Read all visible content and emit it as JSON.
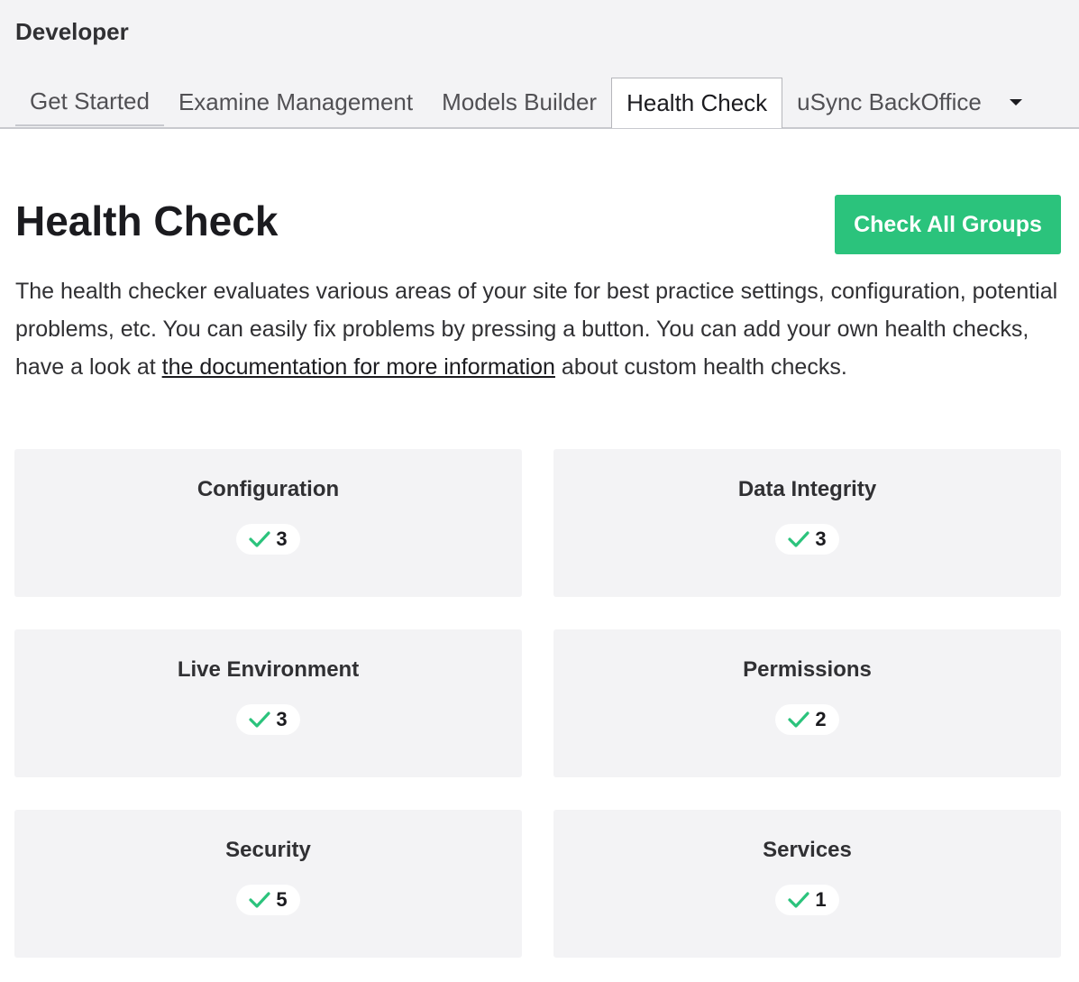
{
  "header": {
    "section": "Developer",
    "tabs": [
      {
        "label": "Get Started"
      },
      {
        "label": "Examine Management"
      },
      {
        "label": "Models Builder"
      },
      {
        "label": "Health Check"
      },
      {
        "label": "uSync BackOffice"
      }
    ],
    "active_tab": "Health Check"
  },
  "main": {
    "title": "Health Check",
    "check_all_label": "Check All Groups",
    "intro_before_link": "The health checker evaluates various areas of your site for best practice settings, configuration, potential problems, etc. You can easily fix problems by pressing a button. You can add your own health checks, have a look at ",
    "intro_link": "the documentation for more information",
    "intro_after_link": " about custom health checks.",
    "groups": [
      {
        "name": "Configuration",
        "count": "3"
      },
      {
        "name": "Data Integrity",
        "count": "3"
      },
      {
        "name": "Live Environment",
        "count": "3"
      },
      {
        "name": "Permissions",
        "count": "2"
      },
      {
        "name": "Security",
        "count": "5"
      },
      {
        "name": "Services",
        "count": "1"
      }
    ]
  },
  "colors": {
    "accent_green": "#2bc37c",
    "card_bg": "#f3f3f5"
  },
  "icons": {
    "success": "check-icon",
    "more_tabs": "caret-down-icon"
  }
}
